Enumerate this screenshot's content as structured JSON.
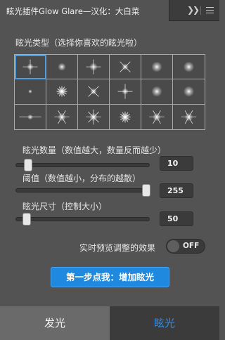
{
  "panel": {
    "title": "眩光插件Glow Glare—汉化：大白菜"
  },
  "titlebar_icons": {
    "collapse": "double-chevron-right-icon",
    "menu": "hamburger-menu-icon"
  },
  "glare_type": {
    "label": "眩光类型（选择你喜欢的眩光啦）",
    "selected_index": 0,
    "presets": [
      "star4",
      "soft",
      "star-cross",
      "star-x",
      "glow-round",
      "glow-round",
      "dot",
      "burst",
      "star-x",
      "star4",
      "glow-round",
      "glow-round",
      "star-h",
      "star6",
      "star8",
      "burst",
      "star6",
      "star6"
    ]
  },
  "glare_count": {
    "label": "眩光数量（数值越大，数量反而越少）",
    "value": "10",
    "slider_fraction": 0.05
  },
  "threshold": {
    "label": "阈值（数值越小，分布的越散）",
    "value": "255",
    "slider_fraction": 1.0
  },
  "glare_size": {
    "label": "眩光尺寸（控制大小）",
    "value": "50",
    "slider_fraction": 0.04
  },
  "realtime_preview": {
    "label": "实时预览调整的效果",
    "state": "OFF"
  },
  "action_button": {
    "label": "第一步点我：增加眩光"
  },
  "tabs": {
    "glow": "发光",
    "glare": "眩光",
    "active": "glare"
  },
  "colors": {
    "accent": "#1f89e0",
    "active_tab_text": "#2e8ce6",
    "panel_bg": "#535353"
  }
}
